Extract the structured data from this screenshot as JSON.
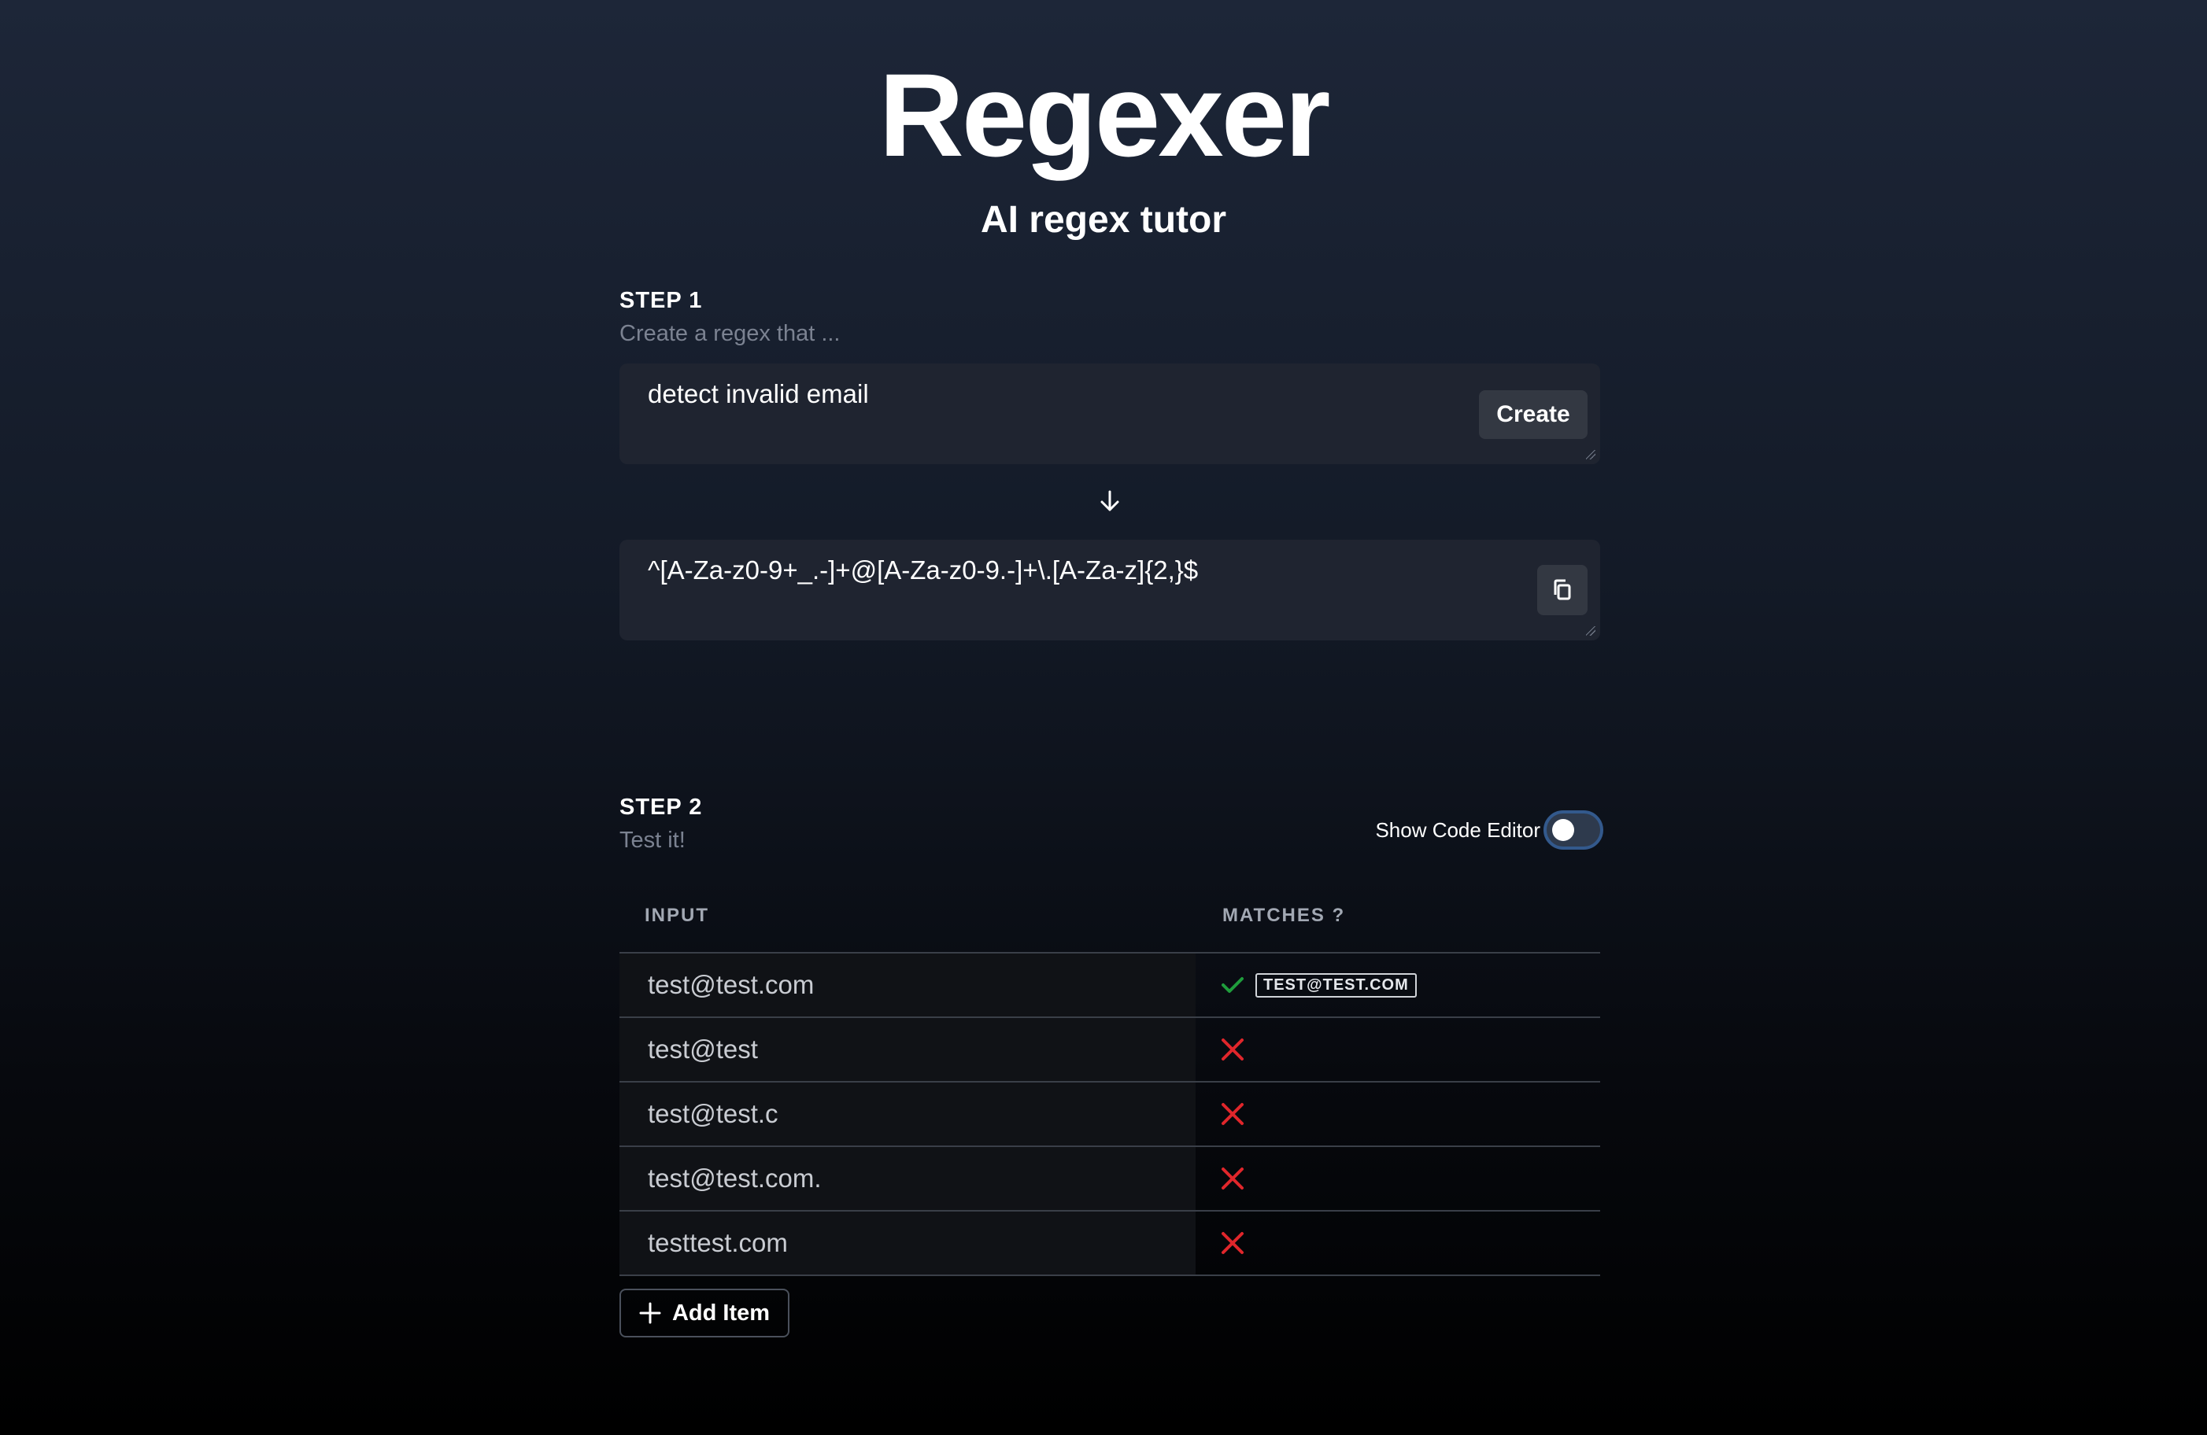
{
  "app": {
    "title": "Regexer",
    "subtitle": "AI regex tutor"
  },
  "step1": {
    "label": "STEP 1",
    "description": "Create a regex that ...",
    "prompt_value": "detect invalid email",
    "create_label": "Create",
    "regex_value": "^[A-Za-z0-9+_.-]+@[A-Za-z0-9.-]+\\.[A-Za-z]{2,}$"
  },
  "step2": {
    "label": "STEP 2",
    "description": "Test it!",
    "toggle_label": "Show Code Editor",
    "toggle_on": false,
    "columns": {
      "input": "INPUT",
      "matches": "MATCHES ?"
    },
    "rows": [
      {
        "input": "test@test.com",
        "match": true,
        "match_text": "TEST@TEST.COM"
      },
      {
        "input": "test@test",
        "match": false
      },
      {
        "input": "test@test.c",
        "match": false
      },
      {
        "input": "test@test.com.",
        "match": false
      },
      {
        "input": "testtest.com",
        "match": false
      }
    ],
    "add_label": "Add Item"
  },
  "colors": {
    "match": "#1f9d3c",
    "no_match": "#e0262b",
    "toggle_border": "#33598c"
  }
}
